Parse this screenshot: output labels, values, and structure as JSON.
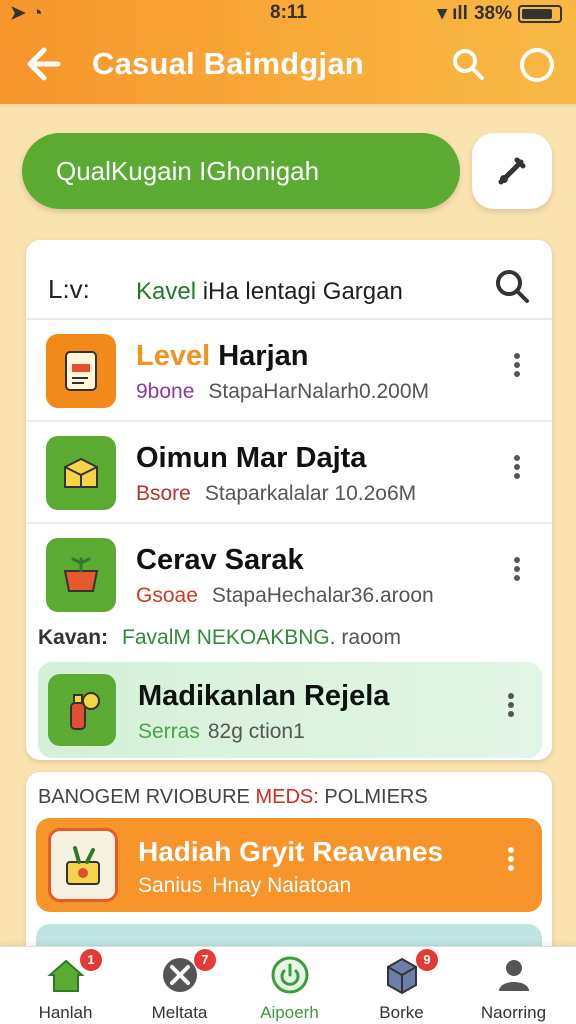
{
  "status": {
    "time": "8:11",
    "battery": "38%"
  },
  "header": {
    "title": "Casual Baimdgjan"
  },
  "search": {
    "pill_text": "QualKugain IGhonigah"
  },
  "list_card": {
    "head_left": "L:v:",
    "head_label_green": "Kavel",
    "head_label_rest": " iHa lentagi Gargan",
    "items": [
      {
        "title_orange": "Level",
        "title_rest": " Harjan",
        "tag": "9bone",
        "tag_color": "#8b3aa8",
        "sub": "StapaHarNalarh0.200M",
        "icon_bg": "#f28a1a"
      },
      {
        "title_orange": "",
        "title_rest": "Oimun Mar Dajta",
        "tag": "Bsore",
        "tag_color": "#b8322a",
        "sub": "Staparkalalar 10.2o6M",
        "icon_bg": "#5bab32"
      },
      {
        "title_orange": "",
        "title_rest": "Cerav Sarak",
        "tag": "Gsoae",
        "tag_color": "#d6371f",
        "sub": "StapaHechalar36.aroon",
        "icon_bg": "#5bab32"
      }
    ],
    "section_line": {
      "k": "Kavan:",
      "f": "FavalM NEKOAKBNG",
      "r": ". raoom"
    },
    "highlight": {
      "title": "Madikanlan Rejela",
      "tag": "Serras",
      "sub": "82g ction1"
    }
  },
  "promo_card": {
    "heading_left": "BANOGEM RVIOBURE ",
    "heading_red": "MEDS:",
    "heading_right": " POLMIERS",
    "item": {
      "title": "Hadiah Gryit Reavanes",
      "tag": "Sanius",
      "sub": "Hnay Naiatoan"
    }
  },
  "nav": [
    {
      "label": "Hanlah",
      "badge": "1"
    },
    {
      "label": "Meltata",
      "badge": "7"
    },
    {
      "label": "Aipoerh",
      "badge": ""
    },
    {
      "label": "Borke",
      "badge": "9"
    },
    {
      "label": "Naorring",
      "badge": ""
    }
  ]
}
